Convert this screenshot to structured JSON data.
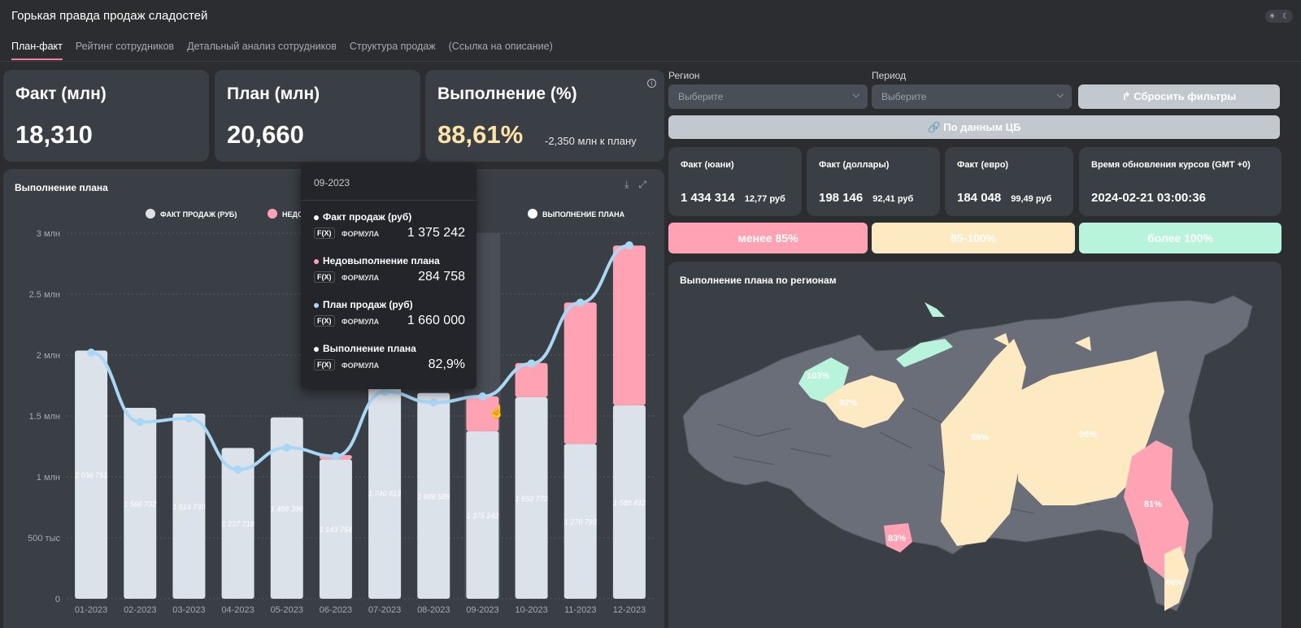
{
  "header": {
    "title": "Горькая правда продаж сладостей",
    "theme_toggle": {
      "light_icon": "sun-icon",
      "dark_icon": "moon-icon"
    }
  },
  "tabs": [
    {
      "label": "План-факт",
      "active": true
    },
    {
      "label": "Рейтинг сотрудников"
    },
    {
      "label": "Детальный анализ сотрудников"
    },
    {
      "label": "Структура продаж"
    },
    {
      "label": "(Ссылка на описание)"
    }
  ],
  "kpis": {
    "fact": {
      "label": "Факт (млн)",
      "value": "18,310"
    },
    "plan": {
      "label": "План (млн)",
      "value": "20,660"
    },
    "completion": {
      "label": "Выполнение (%)",
      "value": "88,61%",
      "sub": "-2,350 млн к плану"
    }
  },
  "filters": {
    "region": {
      "label": "Регион",
      "placeholder": "Выберите"
    },
    "period": {
      "label": "Период",
      "placeholder": "Выберите"
    },
    "reset_label": "Сбросить фильтры",
    "cb_label": "По данным ЦБ"
  },
  "rates": [
    {
      "label": "Факт (юани)",
      "value": "1 434 314",
      "rate": "12,77 руб"
    },
    {
      "label": "Факт (доллары)",
      "value": "198 146",
      "rate": "92,41 руб"
    },
    {
      "label": "Факт (евро)",
      "value": "184 048",
      "rate": "99,49 руб"
    },
    {
      "label": "Время обновления курсов (GMT +0)",
      "value": "2024-02-21 03:00:36",
      "rate": ""
    }
  ],
  "thresholds": [
    {
      "label": "менее 85%",
      "color": "#ffa3b4"
    },
    {
      "label": "85-100%",
      "color": "#fde9c2"
    },
    {
      "label": "более 100%",
      "color": "#b8f3dc"
    }
  ],
  "chart_panel": {
    "title": "Выполнение плана",
    "legend": [
      {
        "label": "ФАКТ ПРОДАЖ (РУБ)",
        "color": "#dce2ea"
      },
      {
        "label": "НЕДОВЫПОЛНЕНИЕ ПЛАНА",
        "color": "#ffa3b4"
      },
      {
        "label": "ПЛАН ПРОДАЖ (РУБ)",
        "color": "#a9d8f5"
      },
      {
        "label": "ВЫПОЛНЕНИЕ ПЛАНА",
        "color": "#ffffff"
      }
    ]
  },
  "chart_data": {
    "type": "bar",
    "categories": [
      "01-2023",
      "02-2023",
      "03-2023",
      "04-2023",
      "05-2023",
      "06-2023",
      "07-2023",
      "08-2023",
      "09-2023",
      "10-2023",
      "11-2023",
      "12-2023"
    ],
    "series": [
      {
        "name": "ФАКТ ПРОДАЖ (РУБ)",
        "type": "bar",
        "values": [
          2036751,
          1566732,
          1519730,
          1237718,
          1488396,
          1143754,
          1740813,
          1688589,
          1375242,
          1653772,
          1270793,
          1588492
        ]
      },
      {
        "name": "НЕДОВЫПОЛНЕНИЕ ПЛАНА",
        "type": "bar-stacked",
        "values": [
          0,
          0,
          0,
          0,
          0,
          35000,
          0,
          0,
          284758,
          280000,
          1160000,
          1310000
        ]
      },
      {
        "name": "ПЛАН ПРОДАЖ (РУБ)",
        "type": "line",
        "values": [
          2020000,
          1450000,
          1480000,
          1060000,
          1240000,
          1170000,
          1700000,
          1610000,
          1660000,
          1930000,
          2430000,
          2900000
        ]
      }
    ],
    "bar_labels": [
      "2 036 751",
      "1 566 732",
      "1 519 730",
      "1 237 718",
      "1 488 396",
      "1 143 754",
      "1 740 813",
      "1 688 589",
      "1 375 242",
      "1 653 772",
      "1 270 793",
      "1 588 492"
    ],
    "yticks": [
      "0",
      "500 тыс",
      "1 млн",
      "1.5 млн",
      "2 млн",
      "2.5 млн",
      "3 млн"
    ],
    "ylim": [
      0,
      3000000
    ],
    "grid": true,
    "title": "Выполнение плана"
  },
  "tooltip": {
    "date": "09-2023",
    "items": [
      {
        "name": "Факт продаж (руб)",
        "formula": "ФОРМУЛА",
        "value": "1 375 242",
        "dot": "#ffffff"
      },
      {
        "name": "Недовыполнение плана",
        "formula": "ФОРМУЛА",
        "value": "284 758",
        "dot": "#ffa3b4"
      },
      {
        "name": "План продаж (руб)",
        "formula": "ФОРМУЛА",
        "value": "1 660 000",
        "dot": "#a9d8f5"
      },
      {
        "name": "Выполнение плана",
        "formula": "ФОРМУЛА",
        "value": "82,9%",
        "dot": "#ffffff"
      }
    ],
    "fx": "F(X)"
  },
  "map_panel": {
    "title": "Выполнение плана по регионам",
    "labels": [
      "103%",
      "92%",
      "89%",
      "96%",
      "81%",
      "83%",
      "86%"
    ]
  }
}
